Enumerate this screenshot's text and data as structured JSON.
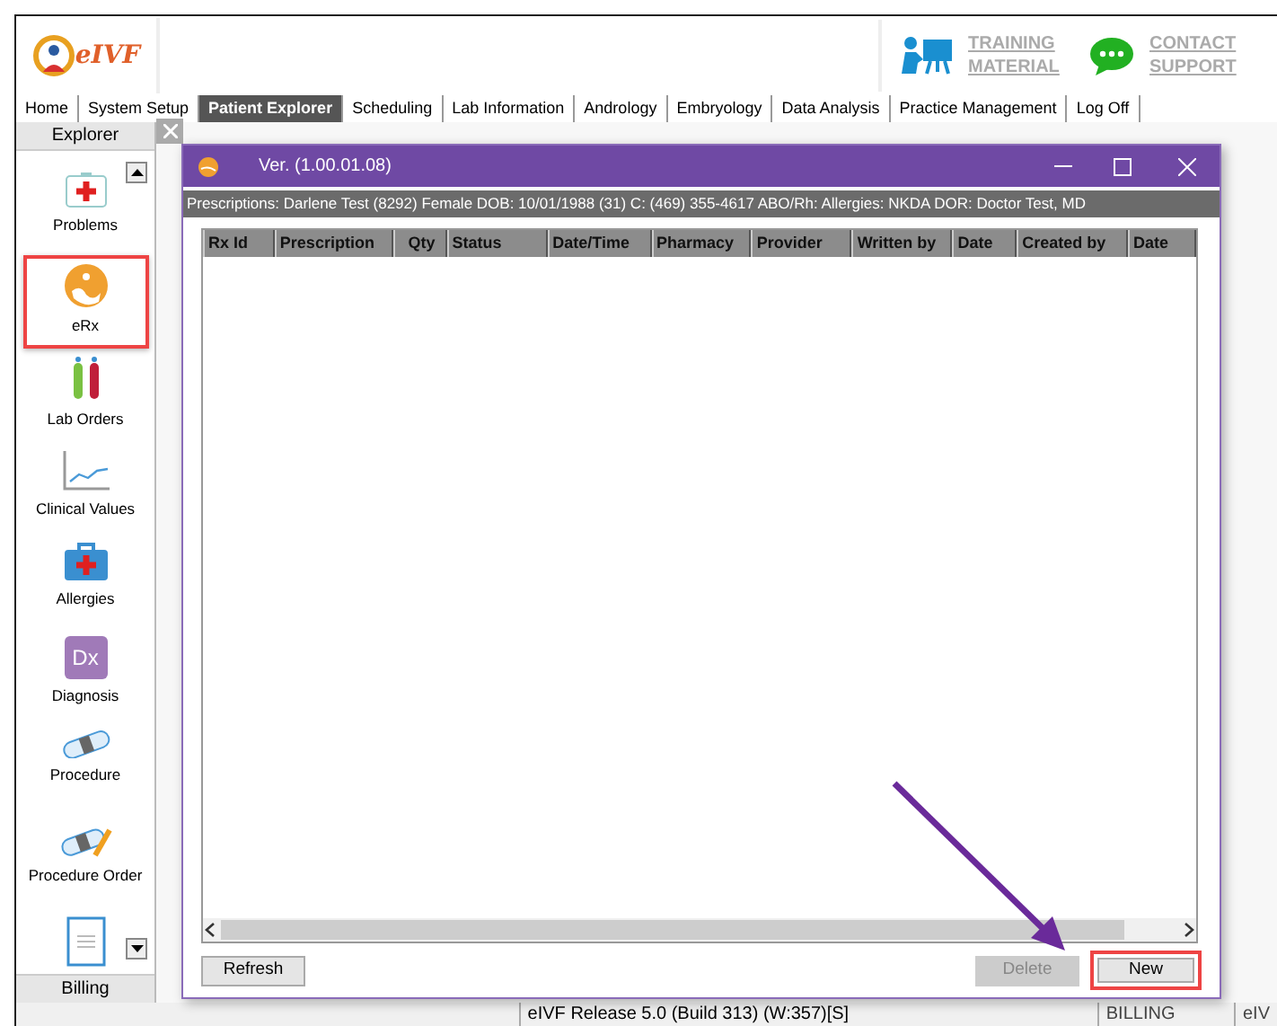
{
  "header": {
    "logo_text": "eIVF",
    "links": [
      {
        "kind": "training",
        "label": "TRAINING MATERIAL"
      },
      {
        "kind": "support",
        "label": "CONTACT SUPPORT"
      }
    ]
  },
  "menu": [
    {
      "label": "Home",
      "selected": false
    },
    {
      "label": "System Setup",
      "selected": false
    },
    {
      "label": "Patient Explorer",
      "selected": true
    },
    {
      "label": "Scheduling",
      "selected": false
    },
    {
      "label": "Lab Information",
      "selected": false
    },
    {
      "label": "Andrology",
      "selected": false
    },
    {
      "label": "Embryology",
      "selected": false
    },
    {
      "label": "Data Analysis",
      "selected": false
    },
    {
      "label": "Practice Management",
      "selected": false
    },
    {
      "label": "Log Off",
      "selected": false
    }
  ],
  "explorer": {
    "title": "Explorer",
    "items": [
      {
        "kind": "problems",
        "label": "Problems",
        "highlighted": false
      },
      {
        "kind": "erx",
        "label": "eRx",
        "highlighted": true
      },
      {
        "kind": "lab",
        "label": "Lab Orders",
        "highlighted": false
      },
      {
        "kind": "chart",
        "label": "Clinical Values",
        "highlighted": false
      },
      {
        "kind": "allergy",
        "label": "Allergies",
        "highlighted": false
      },
      {
        "kind": "dx",
        "label": "Diagnosis",
        "icon_text": "Dx",
        "highlighted": false
      },
      {
        "kind": "procedure",
        "label": "Procedure",
        "highlighted": false
      },
      {
        "kind": "procedure-order",
        "label": "Procedure Order",
        "highlighted": false
      },
      {
        "kind": "document",
        "highlighted": false
      }
    ],
    "footer": "Billing"
  },
  "dialog": {
    "title": "Ver. (1.00.01.08)",
    "patient_info": "Prescriptions: Darlene  Test (8292) Female  DOB: 10/01/1988 (31) C: (469) 355-4617  ABO/Rh:   Allergies: NKDA  DOR: Doctor Test, MD",
    "columns": [
      "Rx Id",
      "Prescription",
      "Qty",
      "Status",
      "Date/Time",
      "Pharmacy",
      "Provider",
      "Written by",
      "Date",
      "Created by",
      "Date"
    ],
    "buttons": [
      {
        "label": "Refresh",
        "disabled": false,
        "highlighted": false
      },
      {
        "label": "Delete",
        "disabled": true,
        "highlighted": false
      },
      {
        "label": "New",
        "disabled": false,
        "highlighted": true
      }
    ]
  },
  "status_bar": [
    "eIVF Release 5.0 (Build 313) (W:357)[S]",
    "BILLING",
    "eIV"
  ]
}
